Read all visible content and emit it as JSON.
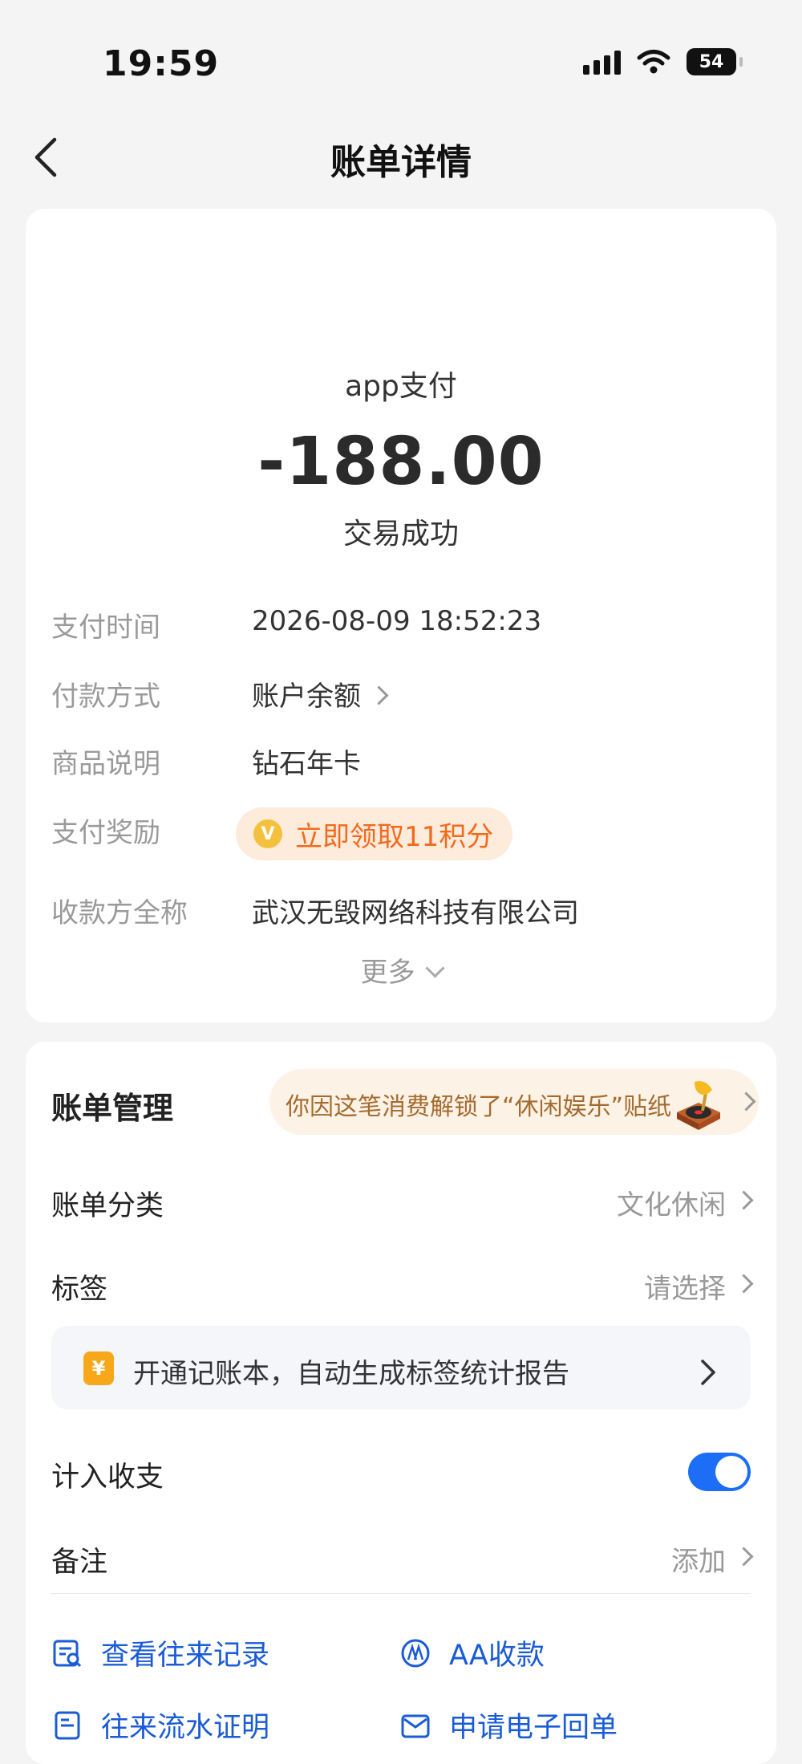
{
  "status_bar": {
    "time": "19:59",
    "battery": "54"
  },
  "nav": {
    "title": "账单详情"
  },
  "transaction": {
    "merchant": "app支付",
    "amount": "-188.00",
    "status": "交易成功"
  },
  "details": {
    "pay_time_label": "支付时间",
    "pay_time_value": "2026-08-09 18:52:23",
    "method_label": "付款方式",
    "method_value": "账户余额",
    "product_label": "商品说明",
    "product_value": "钻石年卡",
    "reward_label": "支付奖励",
    "reward_value": "立即领取11积分",
    "payee_label": "收款方全称",
    "payee_value": "武汉无毁网络科技有限公司",
    "more": "更多"
  },
  "management": {
    "title": "账单管理",
    "sticker_text": "你因这笔消费解锁了“休闲娱乐”贴纸",
    "category_label": "账单分类",
    "category_value": "文化休闲",
    "tag_label": "标签",
    "tag_value": "请选择",
    "promo_icon": "¥",
    "promo_text": "开通记账本，自动生成标签统计报告",
    "include_label": "计入收支",
    "include_on": true,
    "note_label": "备注",
    "note_value": "添加"
  },
  "actions": {
    "history": "查看往来记录",
    "aa": "AA收款",
    "statement": "往来流水证明",
    "receipt": "申请电子回单"
  },
  "colors": {
    "accent": "#1a5bd6",
    "reward": "#f26b1d",
    "toggle": "#1d6ef6"
  }
}
